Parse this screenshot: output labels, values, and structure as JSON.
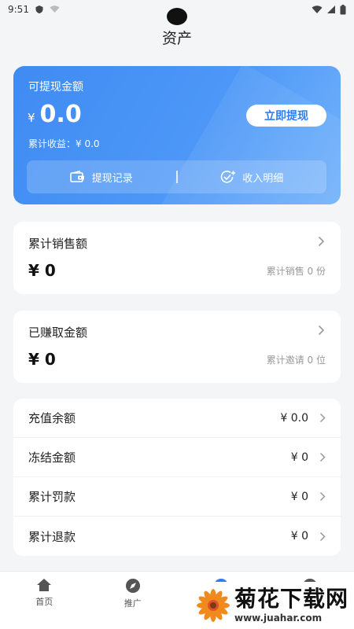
{
  "status_bar": {
    "time": "9:51"
  },
  "page": {
    "title": "资产"
  },
  "balance_card": {
    "label": "可提现金额",
    "currency": "¥",
    "amount": "0.0",
    "total_earnings": "累计收益：¥ 0.0",
    "withdraw_button": "立即提现",
    "actions": [
      {
        "label": "提现记录",
        "icon": "wallet-icon"
      },
      {
        "label": "收入明细",
        "icon": "check-plus-icon"
      }
    ]
  },
  "sales_card": {
    "label": "累计销售额",
    "value": "¥ 0",
    "sub": "累计销售 0 份"
  },
  "earned_card": {
    "label": "已赚取金额",
    "value": "¥ 0",
    "sub": "累计邀请 0 位"
  },
  "list": [
    {
      "label": "充值余额",
      "value": "¥ 0.0"
    },
    {
      "label": "冻结金额",
      "value": "¥ 0"
    },
    {
      "label": "累计罚款",
      "value": "¥ 0"
    },
    {
      "label": "累计退款",
      "value": "¥ 0"
    }
  ],
  "tabs": [
    {
      "label": "首页",
      "icon": "home-icon"
    },
    {
      "label": "推广",
      "icon": "compass-icon"
    },
    {
      "label": "",
      "icon": "asset-icon"
    },
    {
      "label": "",
      "icon": "profile-icon"
    }
  ],
  "watermark": {
    "main": "菊花下载网",
    "url": "www.juahar.com"
  },
  "colors": {
    "accent": "#2f7ef0",
    "card_gradient_start": "#3f8bf2",
    "card_gradient_end": "#74b3fb"
  }
}
